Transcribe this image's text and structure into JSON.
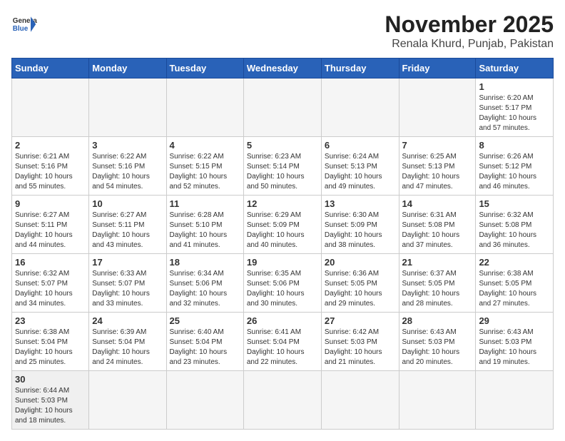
{
  "header": {
    "logo_general": "General",
    "logo_blue": "Blue",
    "month": "November 2025",
    "location": "Renala Khurd, Punjab, Pakistan"
  },
  "weekdays": [
    "Sunday",
    "Monday",
    "Tuesday",
    "Wednesday",
    "Thursday",
    "Friday",
    "Saturday"
  ],
  "weeks": [
    [
      {
        "day": "",
        "info": ""
      },
      {
        "day": "",
        "info": ""
      },
      {
        "day": "",
        "info": ""
      },
      {
        "day": "",
        "info": ""
      },
      {
        "day": "",
        "info": ""
      },
      {
        "day": "",
        "info": ""
      },
      {
        "day": "1",
        "info": "Sunrise: 6:20 AM\nSunset: 5:17 PM\nDaylight: 10 hours\nand 57 minutes."
      }
    ],
    [
      {
        "day": "2",
        "info": "Sunrise: 6:21 AM\nSunset: 5:16 PM\nDaylight: 10 hours\nand 55 minutes."
      },
      {
        "day": "3",
        "info": "Sunrise: 6:22 AM\nSunset: 5:16 PM\nDaylight: 10 hours\nand 54 minutes."
      },
      {
        "day": "4",
        "info": "Sunrise: 6:22 AM\nSunset: 5:15 PM\nDaylight: 10 hours\nand 52 minutes."
      },
      {
        "day": "5",
        "info": "Sunrise: 6:23 AM\nSunset: 5:14 PM\nDaylight: 10 hours\nand 50 minutes."
      },
      {
        "day": "6",
        "info": "Sunrise: 6:24 AM\nSunset: 5:13 PM\nDaylight: 10 hours\nand 49 minutes."
      },
      {
        "day": "7",
        "info": "Sunrise: 6:25 AM\nSunset: 5:13 PM\nDaylight: 10 hours\nand 47 minutes."
      },
      {
        "day": "8",
        "info": "Sunrise: 6:26 AM\nSunset: 5:12 PM\nDaylight: 10 hours\nand 46 minutes."
      }
    ],
    [
      {
        "day": "9",
        "info": "Sunrise: 6:27 AM\nSunset: 5:11 PM\nDaylight: 10 hours\nand 44 minutes."
      },
      {
        "day": "10",
        "info": "Sunrise: 6:27 AM\nSunset: 5:11 PM\nDaylight: 10 hours\nand 43 minutes."
      },
      {
        "day": "11",
        "info": "Sunrise: 6:28 AM\nSunset: 5:10 PM\nDaylight: 10 hours\nand 41 minutes."
      },
      {
        "day": "12",
        "info": "Sunrise: 6:29 AM\nSunset: 5:09 PM\nDaylight: 10 hours\nand 40 minutes."
      },
      {
        "day": "13",
        "info": "Sunrise: 6:30 AM\nSunset: 5:09 PM\nDaylight: 10 hours\nand 38 minutes."
      },
      {
        "day": "14",
        "info": "Sunrise: 6:31 AM\nSunset: 5:08 PM\nDaylight: 10 hours\nand 37 minutes."
      },
      {
        "day": "15",
        "info": "Sunrise: 6:32 AM\nSunset: 5:08 PM\nDaylight: 10 hours\nand 36 minutes."
      }
    ],
    [
      {
        "day": "16",
        "info": "Sunrise: 6:32 AM\nSunset: 5:07 PM\nDaylight: 10 hours\nand 34 minutes."
      },
      {
        "day": "17",
        "info": "Sunrise: 6:33 AM\nSunset: 5:07 PM\nDaylight: 10 hours\nand 33 minutes."
      },
      {
        "day": "18",
        "info": "Sunrise: 6:34 AM\nSunset: 5:06 PM\nDaylight: 10 hours\nand 32 minutes."
      },
      {
        "day": "19",
        "info": "Sunrise: 6:35 AM\nSunset: 5:06 PM\nDaylight: 10 hours\nand 30 minutes."
      },
      {
        "day": "20",
        "info": "Sunrise: 6:36 AM\nSunset: 5:05 PM\nDaylight: 10 hours\nand 29 minutes."
      },
      {
        "day": "21",
        "info": "Sunrise: 6:37 AM\nSunset: 5:05 PM\nDaylight: 10 hours\nand 28 minutes."
      },
      {
        "day": "22",
        "info": "Sunrise: 6:38 AM\nSunset: 5:05 PM\nDaylight: 10 hours\nand 27 minutes."
      }
    ],
    [
      {
        "day": "23",
        "info": "Sunrise: 6:38 AM\nSunset: 5:04 PM\nDaylight: 10 hours\nand 25 minutes."
      },
      {
        "day": "24",
        "info": "Sunrise: 6:39 AM\nSunset: 5:04 PM\nDaylight: 10 hours\nand 24 minutes."
      },
      {
        "day": "25",
        "info": "Sunrise: 6:40 AM\nSunset: 5:04 PM\nDaylight: 10 hours\nand 23 minutes."
      },
      {
        "day": "26",
        "info": "Sunrise: 6:41 AM\nSunset: 5:04 PM\nDaylight: 10 hours\nand 22 minutes."
      },
      {
        "day": "27",
        "info": "Sunrise: 6:42 AM\nSunset: 5:03 PM\nDaylight: 10 hours\nand 21 minutes."
      },
      {
        "day": "28",
        "info": "Sunrise: 6:43 AM\nSunset: 5:03 PM\nDaylight: 10 hours\nand 20 minutes."
      },
      {
        "day": "29",
        "info": "Sunrise: 6:43 AM\nSunset: 5:03 PM\nDaylight: 10 hours\nand 19 minutes."
      }
    ],
    [
      {
        "day": "30",
        "info": "Sunrise: 6:44 AM\nSunset: 5:03 PM\nDaylight: 10 hours\nand 18 minutes."
      },
      {
        "day": "",
        "info": ""
      },
      {
        "day": "",
        "info": ""
      },
      {
        "day": "",
        "info": ""
      },
      {
        "day": "",
        "info": ""
      },
      {
        "day": "",
        "info": ""
      },
      {
        "day": "",
        "info": ""
      }
    ]
  ]
}
